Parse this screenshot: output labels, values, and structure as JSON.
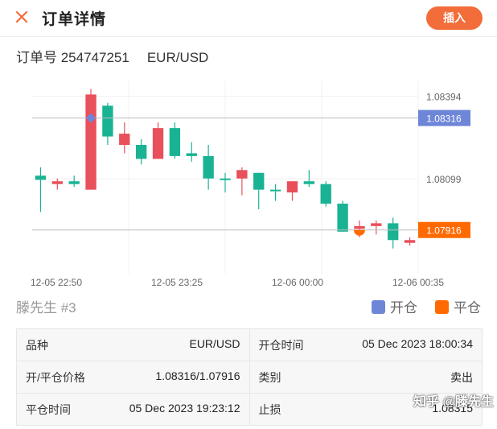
{
  "header": {
    "title": "订单详情",
    "insert_label": "插入",
    "accent": "#f26d3a"
  },
  "order": {
    "label_number": "订单号 254747251",
    "symbol": "EUR/USD"
  },
  "chart_data": {
    "type": "candlestick",
    "x_tick_labels": [
      "12-05 22:50",
      "12-05 23:25",
      "12-06 00:00",
      "12-06 00:35"
    ],
    "y_tick_labels": [
      "1.08394",
      "1.08099"
    ],
    "ylim": [
      1.0776,
      1.0845
    ],
    "open_price": 1.08316,
    "close_price": 1.07916,
    "open_label": "1.08316",
    "close_label": "1.07916",
    "colors": {
      "up": "#19b394",
      "down": "#e8505b",
      "open": "#6d86d8",
      "close": "#ff6a00"
    },
    "candles": [
      {
        "o": 1.08095,
        "c": 1.0811,
        "h": 1.0814,
        "l": 1.0798
      },
      {
        "o": 1.0809,
        "c": 1.0808,
        "h": 1.081,
        "l": 1.0806
      },
      {
        "o": 1.0808,
        "c": 1.0809,
        "h": 1.0811,
        "l": 1.0807
      },
      {
        "o": 1.084,
        "c": 1.0806,
        "h": 1.0842,
        "l": 1.0806
      },
      {
        "o": 1.0825,
        "c": 1.0836,
        "h": 1.0837,
        "l": 1.0822
      },
      {
        "o": 1.0826,
        "c": 1.0822,
        "h": 1.083,
        "l": 1.0819
      },
      {
        "o": 1.0817,
        "c": 1.0822,
        "h": 1.0824,
        "l": 1.0815
      },
      {
        "o": 1.0828,
        "c": 1.0817,
        "h": 1.083,
        "l": 1.0817
      },
      {
        "o": 1.0818,
        "c": 1.0828,
        "h": 1.083,
        "l": 1.0817
      },
      {
        "o": 1.0818,
        "c": 1.0819,
        "h": 1.0823,
        "l": 1.0816
      },
      {
        "o": 1.081,
        "c": 1.0818,
        "h": 1.0822,
        "l": 1.0806
      },
      {
        "o": 1.081,
        "c": 1.081,
        "h": 1.0812,
        "l": 1.0805
      },
      {
        "o": 1.0813,
        "c": 1.081,
        "h": 1.0814,
        "l": 1.0804
      },
      {
        "o": 1.0806,
        "c": 1.0812,
        "h": 1.0812,
        "l": 1.0799
      },
      {
        "o": 1.0806,
        "c": 1.0806,
        "h": 1.0808,
        "l": 1.0802
      },
      {
        "o": 1.0809,
        "c": 1.0805,
        "h": 1.0809,
        "l": 1.0802
      },
      {
        "o": 1.0808,
        "c": 1.0809,
        "h": 1.0813,
        "l": 1.0807
      },
      {
        "o": 1.0801,
        "c": 1.0808,
        "h": 1.0809,
        "l": 1.08
      },
      {
        "o": 1.0791,
        "c": 1.0801,
        "h": 1.0802,
        "l": 1.0791
      },
      {
        "o": 1.0793,
        "c": 1.0792,
        "h": 1.0795,
        "l": 1.0789
      },
      {
        "o": 1.0794,
        "c": 1.0793,
        "h": 1.0795,
        "l": 1.079
      },
      {
        "o": 1.0788,
        "c": 1.0794,
        "h": 1.0796,
        "l": 1.0785
      },
      {
        "o": 1.0788,
        "c": 1.0787,
        "h": 1.0789,
        "l": 1.0786
      }
    ]
  },
  "legend": {
    "trader": "滕先生 #3",
    "open_label": "开仓",
    "close_label": "平仓"
  },
  "details": [
    [
      {
        "k": "品种",
        "v": "EUR/USD"
      },
      {
        "k": "开仓时间",
        "v": "05 Dec 2023 18:00:34"
      }
    ],
    [
      {
        "k": "开/平仓价格",
        "v": "1.08316/1.07916"
      },
      {
        "k": "类别",
        "v": "卖出"
      }
    ],
    [
      {
        "k": "平仓时间",
        "v": "05 Dec 2023 19:23:12"
      },
      {
        "k": "止损",
        "v": "1.08315"
      }
    ]
  ],
  "watermark": "知乎 @滕先生"
}
